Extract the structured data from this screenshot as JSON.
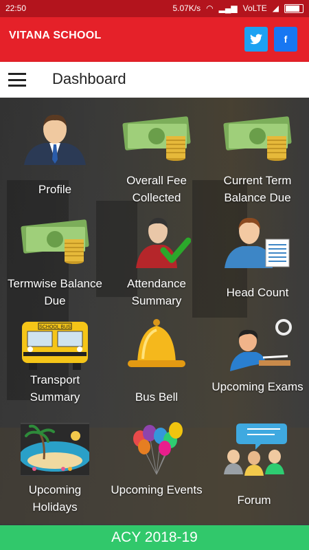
{
  "status": {
    "time": "22:50",
    "speed": "5.07K/s",
    "network": "VoLTE"
  },
  "app": {
    "title": "VITANA SCHOOL",
    "twitter": "t",
    "facebook": "f"
  },
  "toolbar": {
    "title": "Dashboard"
  },
  "tiles": [
    {
      "label": "Profile",
      "icon": "profile-icon"
    },
    {
      "label": "Overall Fee Collected",
      "icon": "money-icon"
    },
    {
      "label": "Current Term Balance Due",
      "icon": "money-icon"
    },
    {
      "label": "Termwise Balance Due",
      "icon": "money-icon"
    },
    {
      "label": "Attendance Summary",
      "icon": "attendance-icon"
    },
    {
      "label": "Head Count",
      "icon": "head-count-icon"
    },
    {
      "label": "Transport Summary",
      "icon": "school-bus-icon"
    },
    {
      "label": "Bus Bell",
      "icon": "bell-icon"
    },
    {
      "label": "Upcoming Exams",
      "icon": "exam-icon"
    },
    {
      "label": "Upcoming Holidays",
      "icon": "holiday-icon"
    },
    {
      "label": "Upcoming Events",
      "icon": "balloons-icon"
    },
    {
      "label": "Forum",
      "icon": "forum-icon"
    }
  ],
  "bus_text": "SCHOOL BUS",
  "footer": {
    "academic_year": "ACY 2018-19"
  },
  "colors": {
    "appbar": "#e52129",
    "footer": "#31c86b"
  }
}
